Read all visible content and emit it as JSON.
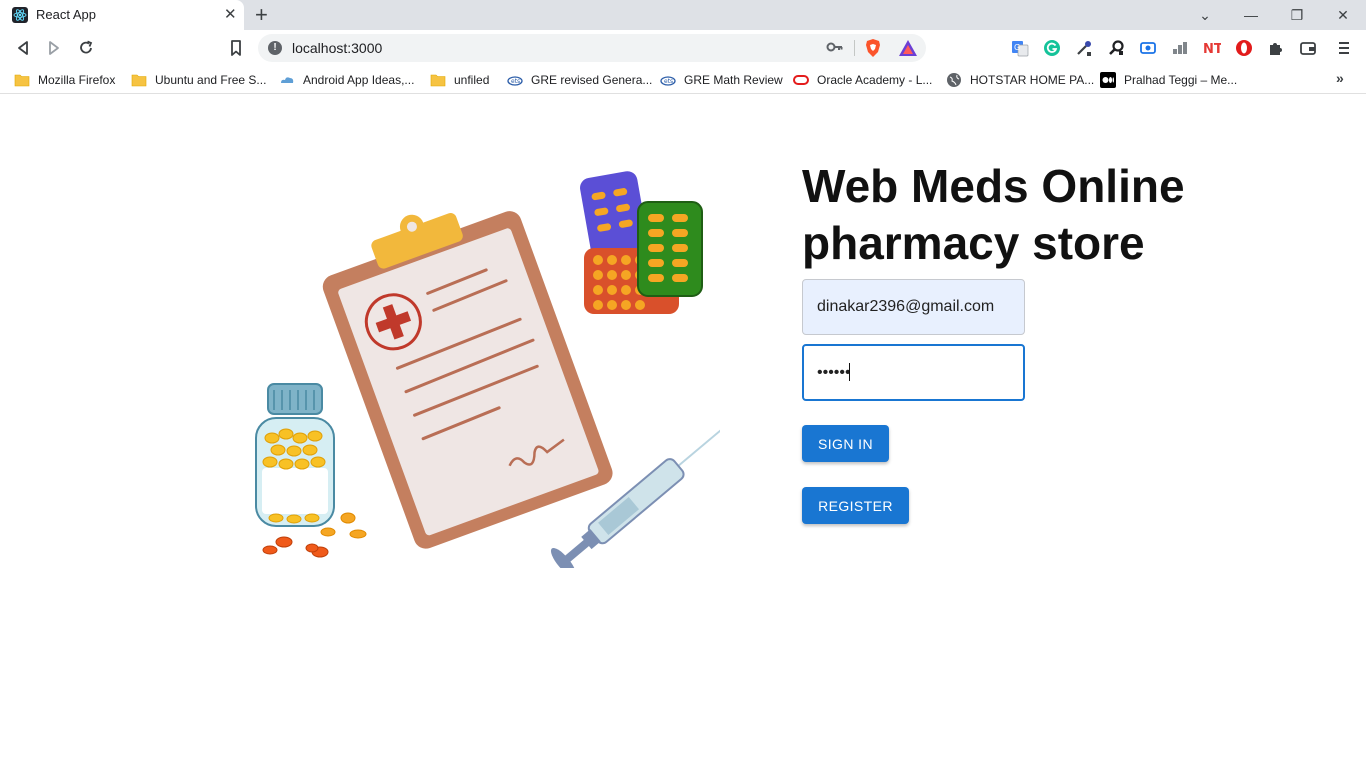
{
  "browser": {
    "tab_title": "React App",
    "tab_close": "✕",
    "new_tab": "+",
    "url": "localhost:3000",
    "window_controls": {
      "tab_search": "⌄",
      "minimize": "—",
      "restore": "❐",
      "close": "✕"
    },
    "bookmarks": [
      {
        "label": "Mozilla Firefox",
        "icon": "folder-icon"
      },
      {
        "label": "Ubuntu and Free S...",
        "icon": "folder-icon"
      },
      {
        "label": "Android App Ideas,...",
        "icon": "cloud-icon"
      },
      {
        "label": "unfiled",
        "icon": "folder-icon"
      },
      {
        "label": "GRE revised Genera...",
        "icon": "ets-icon"
      },
      {
        "label": "GRE Math Review",
        "icon": "ets-icon"
      },
      {
        "label": "Oracle Academy - L...",
        "icon": "oracle-icon"
      },
      {
        "label": "HOTSTAR HOME PA...",
        "icon": "globe-icon"
      },
      {
        "label": "Pralhad Teggi – Me...",
        "icon": "medium-icon"
      }
    ],
    "bookmarks_more": "»"
  },
  "page": {
    "heading": "Web Meds Online pharmacy store",
    "email_value": "dinakar2396@gmail.com",
    "password_masked": "••••••",
    "signin_label": "SIGN IN",
    "register_label": "REGISTER"
  },
  "colors": {
    "primary_button": "#1976d2",
    "autofill_background": "#e8f0fe",
    "focus_border": "#1976d2"
  }
}
